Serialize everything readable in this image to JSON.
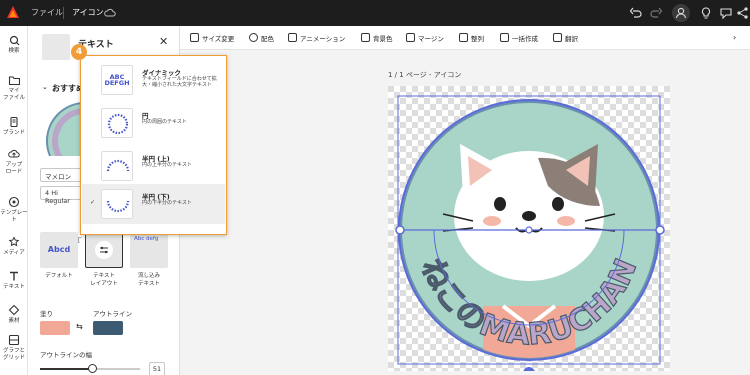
{
  "topbar": {
    "file_label": "ファイル",
    "doc_title": "アイコン"
  },
  "rail": [
    {
      "label": "検索",
      "icon": "search-icon"
    },
    {
      "label": "マイ\nファイル",
      "icon": "folder-icon"
    },
    {
      "label": "ブランド",
      "icon": "brand-icon"
    },
    {
      "label": "アップ\nロード",
      "icon": "upload-icon"
    },
    {
      "label": "テンプレー\nト",
      "icon": "template-icon"
    },
    {
      "label": "メディア",
      "icon": "media-icon"
    },
    {
      "label": "テキスト",
      "icon": "text-icon"
    },
    {
      "label": "素材",
      "icon": "elements-icon"
    },
    {
      "label": "グラフと\nグリッド",
      "icon": "grid-icon"
    }
  ],
  "panel": {
    "title": "テキスト",
    "section": "おすすめ",
    "font_value": "マメロン",
    "weight_value": "4 Hi Regular",
    "cards": [
      {
        "label": "デフォルト",
        "preview": "Abcd"
      },
      {
        "label": "テキスト\nレイアウト",
        "preview": ""
      },
      {
        "label": "流し込み\nテキスト",
        "preview": "Abc defg"
      }
    ],
    "fill_label": "塗り",
    "outline_label": "アウトライン",
    "outline_width_label": "アウトラインの幅",
    "outline_width_value": "51",
    "fill_color": "#f2a896",
    "outline_color": "#3d5a73"
  },
  "toolbar": {
    "items": [
      "サイズ変更",
      "配色",
      "アニメーション",
      "背景色",
      "マージン",
      "整列",
      "一括作成",
      "翻訳"
    ]
  },
  "canvas": {
    "page_label": "1 / 1 ページ - アイコン",
    "arc_text": "ねこのMARUCHAN"
  },
  "popup": {
    "badge": "4",
    "items": [
      {
        "title": "ダイナミック",
        "desc": "テキストフィールドに合わせて拡大・縮小された大文字テキスト",
        "preview": "ABC DEFGH"
      },
      {
        "title": "円",
        "desc": "円の周囲のテキスト",
        "preview": ""
      },
      {
        "title": "半円 (上)",
        "desc": "円の上半分のテキスト",
        "preview": ""
      },
      {
        "title": "半円 (下)",
        "desc": "円の下半分のテキスト",
        "preview": ""
      }
    ],
    "selected_index": 3
  },
  "colors": {
    "accent": "#f29c38",
    "selection": "#5b6bd9",
    "circle_fill": "#a8d5c8",
    "arc_text": "#b9a6c9"
  }
}
